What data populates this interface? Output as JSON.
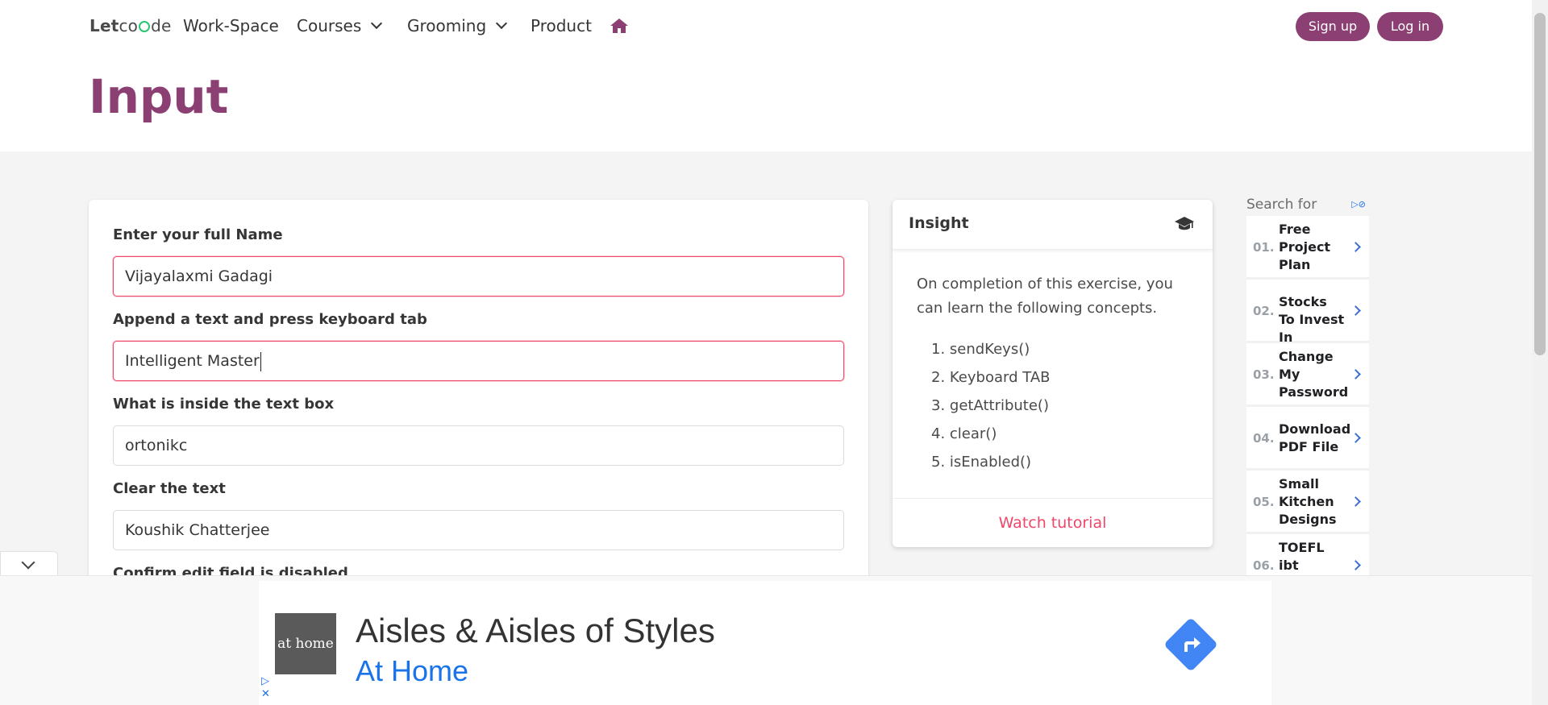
{
  "nav": {
    "logo_let": "Let",
    "logo_de": "de",
    "items": [
      "Work-Space",
      "Courses",
      "Grooming",
      "Product"
    ],
    "signup": "Sign up",
    "login": "Log in"
  },
  "page": {
    "title": "Input"
  },
  "form": {
    "fields": [
      {
        "label": "Enter your full Name",
        "value": "Vijayalaxmi Gadagi"
      },
      {
        "label": "Append a text and press keyboard tab",
        "value": "Intelligent Master"
      },
      {
        "label": "What is inside the text box",
        "value": "ortonikc"
      },
      {
        "label": "Clear the text",
        "value": "Koushik Chatterjee"
      },
      {
        "label": "Confirm edit field is disabled",
        "value": ""
      }
    ]
  },
  "insight": {
    "title": "Insight",
    "body": "On completion of this exercise, you can learn the following concepts.",
    "concepts": [
      "1. sendKeys()",
      "2. Keyboard TAB",
      "3. getAttribute()",
      "4. clear()",
      "5. isEnabled()"
    ],
    "footer": "Watch tutorial"
  },
  "side_ad": {
    "header": "Search for",
    "items": [
      {
        "num": "01.",
        "text": "Free Project Plan"
      },
      {
        "num": "02.",
        "text": "Stocks To Invest In"
      },
      {
        "num": "03.",
        "text": "Change My Password"
      },
      {
        "num": "04.",
        "text": "Download PDF File"
      },
      {
        "num": "05.",
        "text": "Small Kitchen Designs"
      },
      {
        "num": "06.",
        "text": "TOEFL ibt Practice"
      }
    ]
  },
  "banner": {
    "logo": "at home",
    "title": "Aisles & Aisles of Styles",
    "subtitle": "At Home"
  },
  "colors": {
    "brand": "#8b3f72",
    "danger": "#f14668",
    "ad_blue": "#1a73e8"
  }
}
